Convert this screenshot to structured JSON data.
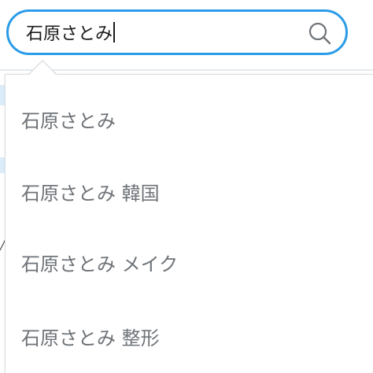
{
  "search": {
    "query": "石原さとみ",
    "icon": "search-icon"
  },
  "suggestions": [
    {
      "label": "石原さとみ"
    },
    {
      "label": "石原さとみ 韓国"
    },
    {
      "label": "石原さとみ メイク"
    },
    {
      "label": "石原さとみ 整形"
    }
  ],
  "colors": {
    "accent": "#2b9ce8",
    "suggestion_text": "#6e7378",
    "query_text": "#1a1a1a"
  }
}
